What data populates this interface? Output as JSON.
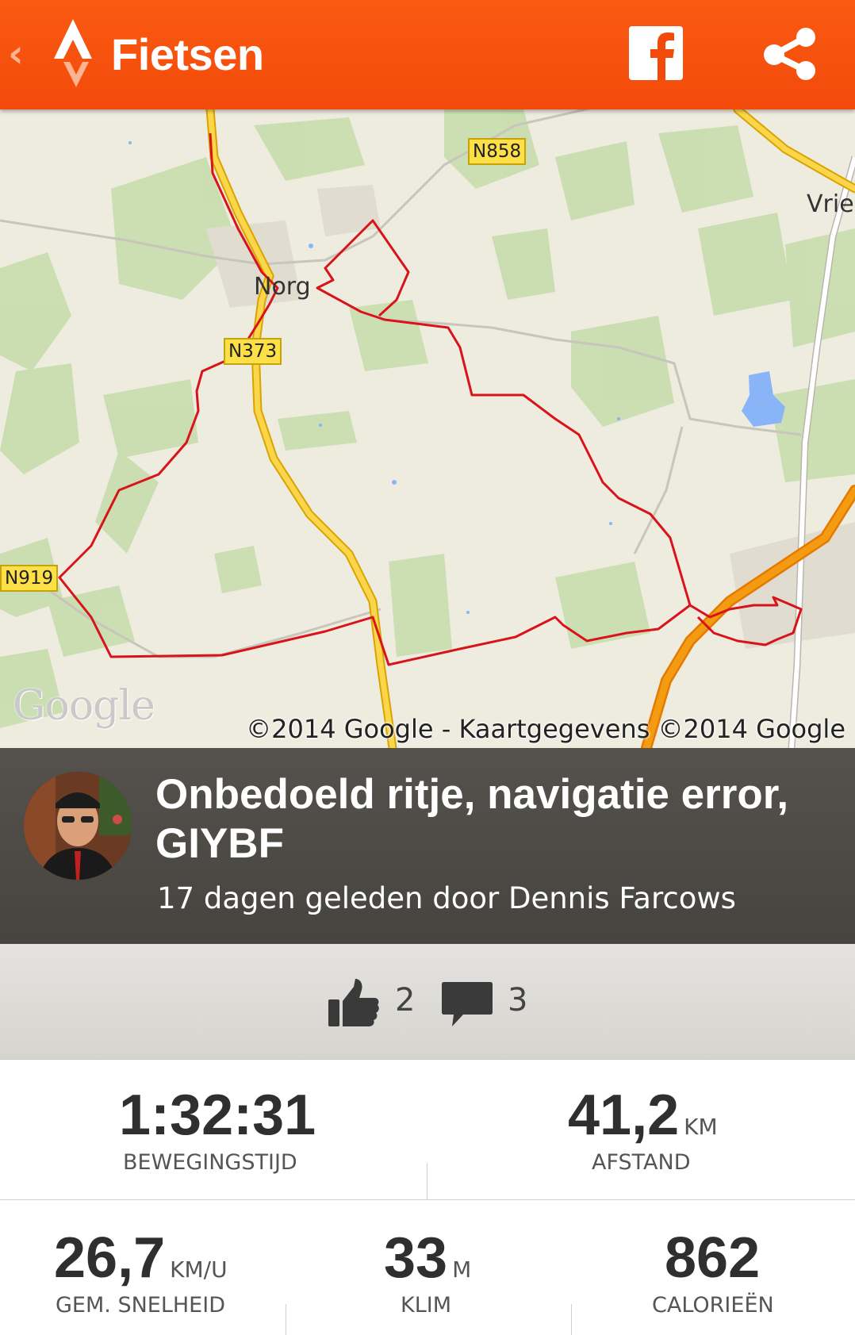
{
  "header": {
    "back_icon": "chevron-left-icon",
    "logo_icon": "strava-logo-icon",
    "title": "Fietsen",
    "facebook_icon": "facebook-icon",
    "share_icon": "share-icon",
    "color": "#f8500e"
  },
  "map": {
    "road_labels": [
      "N858",
      "N373",
      "N919"
    ],
    "place_labels": [
      "Norg",
      "Vries"
    ],
    "google_logo": "Google",
    "copyright": "©2014 Google - Kaartgegevens ©2014 Google",
    "route_color": "#d8141a"
  },
  "activity": {
    "title": "Onbedoeld ritje, navigatie error, GIYBF",
    "subtitle": "17 dagen geleden door Dennis Farcows",
    "avatar_icon": "avatar"
  },
  "social": {
    "kudos_icon": "thumbs-up-icon",
    "kudos_count": "2",
    "comments_icon": "comment-icon",
    "comments_count": "3"
  },
  "stats": {
    "moving_time": {
      "value": "1:32:31",
      "unit": "",
      "label": "BEWEGINGSTIJD"
    },
    "distance": {
      "value": "41,2",
      "unit": "KM",
      "label": "AFSTAND"
    },
    "avg_speed": {
      "value": "26,7",
      "unit": "KM/U",
      "label": "GEM. SNELHEID"
    },
    "climb": {
      "value": "33",
      "unit": "M",
      "label": "KLIM"
    },
    "calories": {
      "value": "862",
      "unit": "",
      "label": "CALORIEËN"
    }
  }
}
